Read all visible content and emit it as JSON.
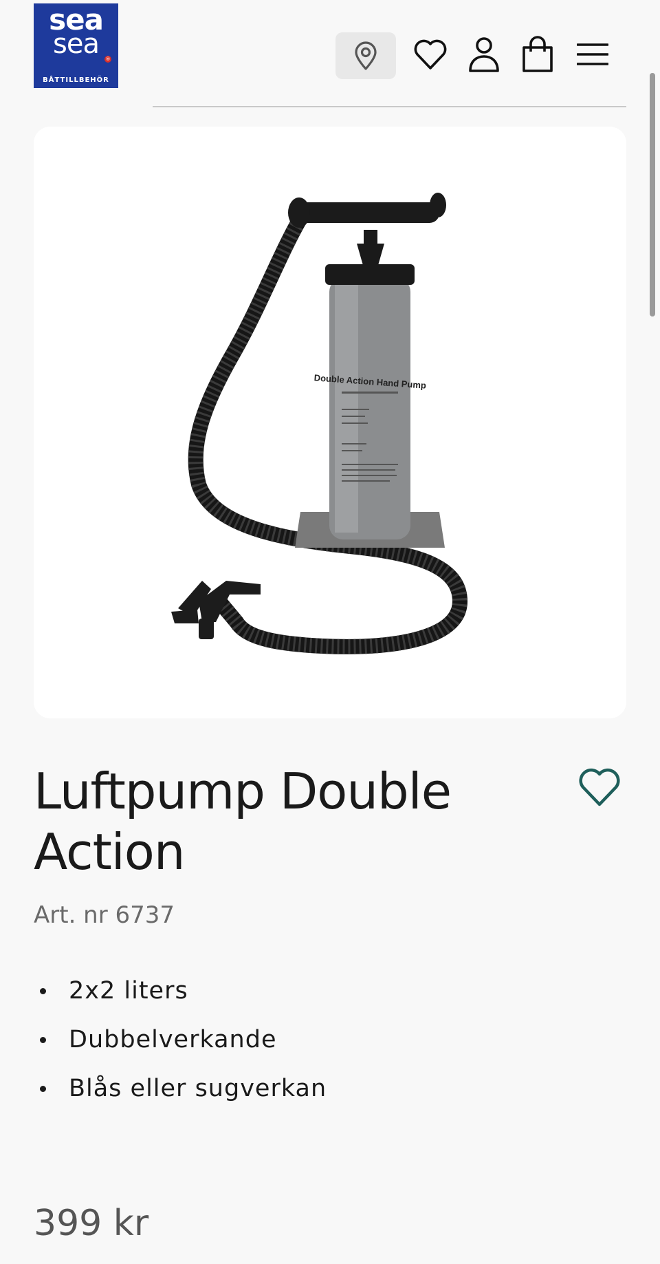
{
  "header": {
    "logo": {
      "line1": "sea",
      "line2": "sea",
      "tagline": "BÅTTILLBEHÖR",
      "registered": "®"
    },
    "icons": [
      "location-pin-icon",
      "heart-icon",
      "user-icon",
      "shopping-bag-icon",
      "hamburger-menu-icon"
    ]
  },
  "product": {
    "image_alt": "Double Action Hand Pump",
    "image_text": "Double Action Hand Pump",
    "title": "Luftpump Double Action",
    "art_nr": "Art. nr 6737",
    "features": [
      "2x2 liters",
      "Dubbelverkande",
      "Blås eller sugverkan"
    ],
    "price": "399 kr"
  },
  "colors": {
    "logo_bg": "#1e3a9c",
    "wishlist_heart": "#1f5f5b",
    "background": "#f8f8f8"
  }
}
